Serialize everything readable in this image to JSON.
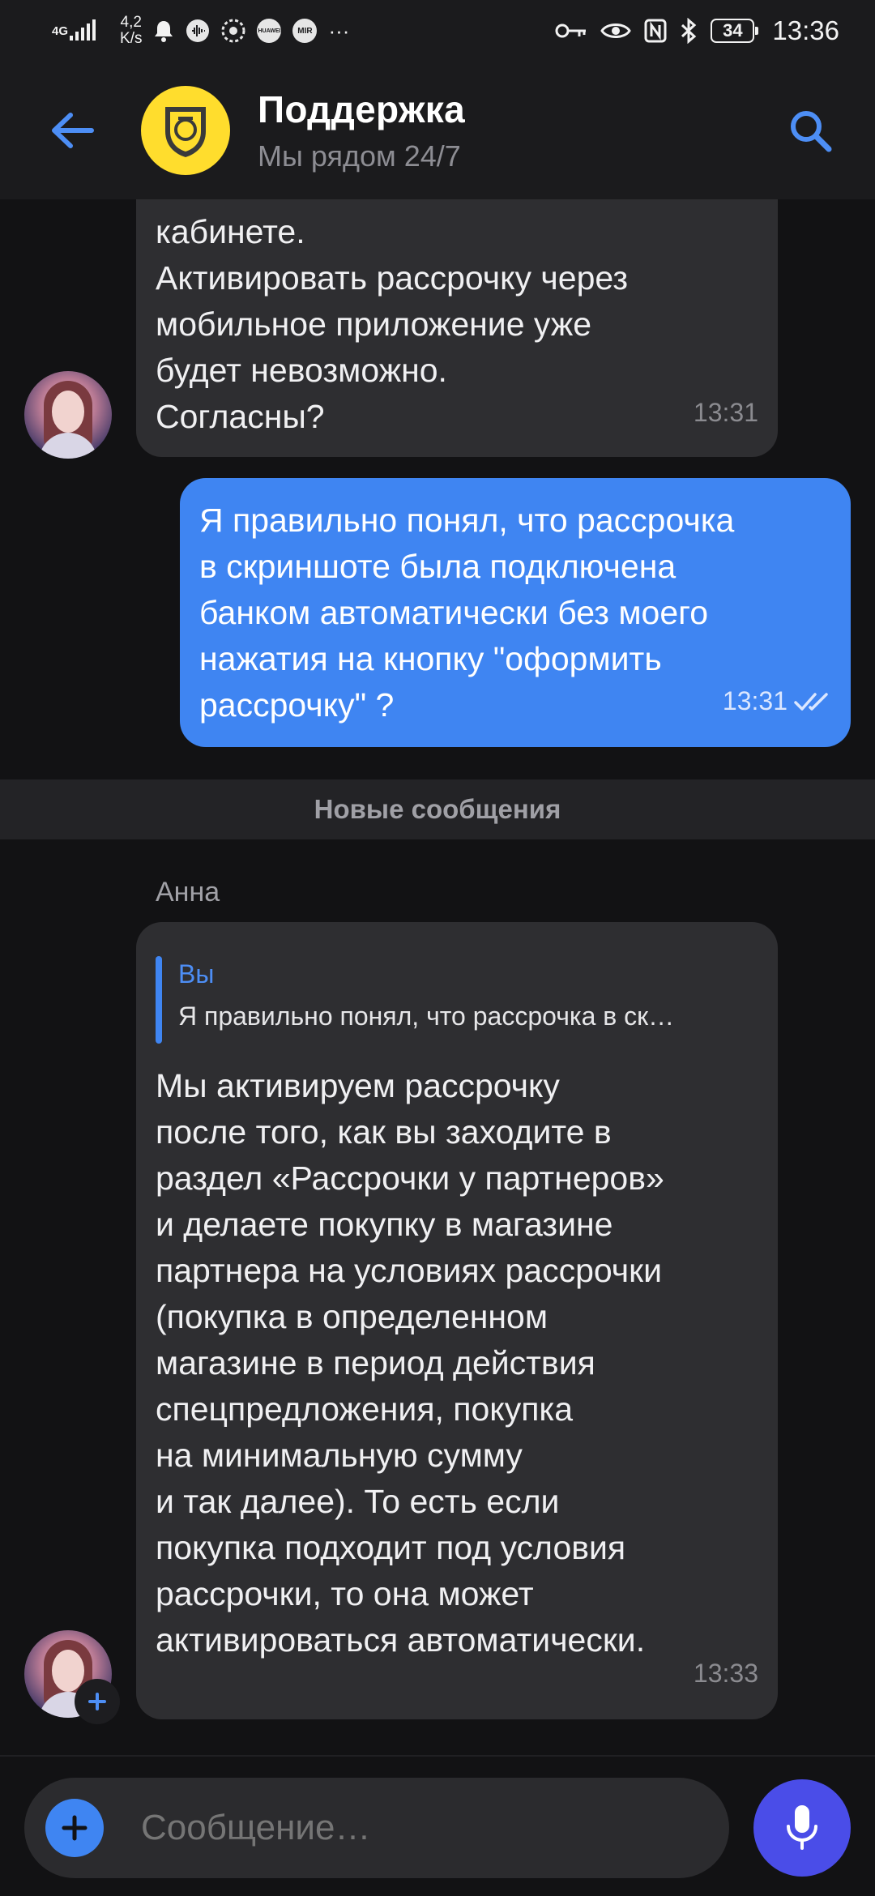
{
  "status_bar": {
    "network": "4G",
    "speed_value": "4,2",
    "speed_unit": "K/s",
    "notif_huawei": "HUAWEI",
    "notif_mir": "MIR",
    "more": "···",
    "battery": "34",
    "time": "13:36"
  },
  "header": {
    "title": "Поддержка",
    "subtitle": "Мы рядом 24/7",
    "back_icon": "arrow-left-icon",
    "search_icon": "search-icon",
    "accent_color": "#3f85f2",
    "logo_color": "#ffdd2d"
  },
  "messages": [
    {
      "type": "incoming",
      "text": "кабинете.\nАктивировать рассрочку через\nмобильное приложение уже\nбудет невозможно.\nСогласны?",
      "time": "13:31"
    },
    {
      "type": "outgoing",
      "text": "Я правильно понял, что рассрочка\nв скриншоте была подключена\nбанком автоматически без моего\nнажатия на кнопку \"оформить\nрассрочку\" ?",
      "time": "13:31",
      "status_icon": "double-check-icon"
    },
    {
      "type": "incoming",
      "sender": "Анна",
      "reply_author": "Вы",
      "reply_text": "Я правильно понял, что рассрочка в ск…",
      "text": "Мы активируем рассрочку\nпосле того, как вы заходите в\nраздел «Рассрочки у партнеров»\nи делаете покупку в магазине\nпартнера на условиях рассрочки\n(покупка в определенном\nмагазине в период действия\nспецпредложения, покупка\nна минимальную сумму\nи так далее). То есть если\nпокупка подходит под условия\nрассрочки, то она может\nактивироваться автоматически.",
      "time": "13:33"
    }
  ],
  "divider": {
    "label": "Новые сообщения"
  },
  "composer": {
    "placeholder": "Сообщение…",
    "attach_icon": "plus-icon",
    "mic_icon": "microphone-icon",
    "mic_color": "#4a4de8"
  }
}
